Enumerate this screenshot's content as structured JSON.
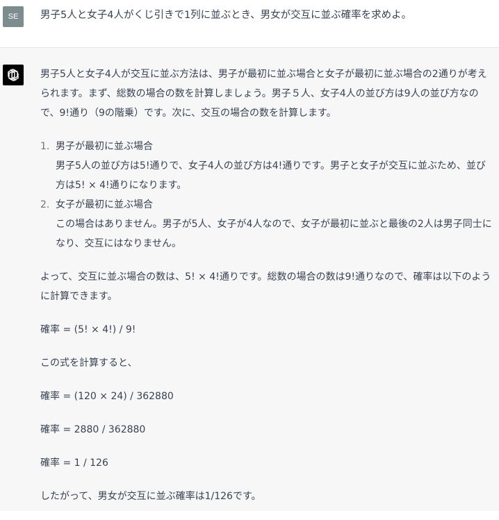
{
  "user": {
    "avatar_initials": "SE",
    "message": "男子5人と女子4人がくじ引きで1列に並ぶとき、男女が交互に並ぶ確率を求めよ。"
  },
  "assistant": {
    "logo_icon": "openai-logo-icon",
    "intro": "男子5人と女子4人が交互に並ぶ方法は、男子が最初に並ぶ場合と女子が最初に並ぶ場合の2通りが考えられます。まず、総数の場合の数を計算しましょう。男子５人、女子4人の並び方は9人の並び方なので、9!通り（9の階乗）です。次に、交互の場合の数を計算します。",
    "list": [
      {
        "num": "1.",
        "title": "男子が最初に並ぶ場合",
        "body": "男子5人の並び方は5!通りで、女子4人の並び方は4!通りです。男子と女子が交互に並ぶため、並び方は5! × 4!通りになります。"
      },
      {
        "num": "2.",
        "title": "女子が最初に並ぶ場合",
        "body": "この場合はありません。男子が5人、女子が4人なので、女子が最初に並ぶと最後の2人は男子同士になり、交互にはなりません。"
      }
    ],
    "conclusion": "よって、交互に並ぶ場合の数は、5! × 4!通りです。総数の場合の数は9!通りなので、確率は以下のように計算できます。",
    "formula1": "確率 = (5! × 4!) / 9!",
    "compute_note": "この式を計算すると、",
    "formula2": "確率 = (120 × 24) / 362880",
    "formula3": "確率 = 2880 / 362880",
    "formula4": "確率 = 1 / 126",
    "final": "したがって、男女が交互に並ぶ確率は1/126です。"
  }
}
